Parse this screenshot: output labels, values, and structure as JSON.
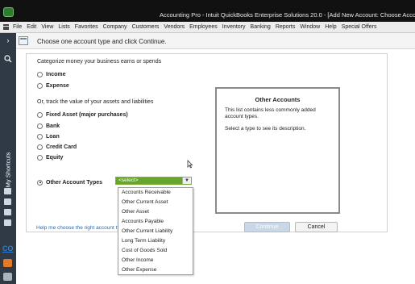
{
  "window": {
    "title": "Accounting Pro - Intuit QuickBooks Enterprise Solutions 20.0 - [Add New Account: Choose Accou"
  },
  "menubar": {
    "items": [
      "File",
      "Edit",
      "View",
      "Lists",
      "Favorites",
      "Company",
      "Customers",
      "Vendors",
      "Employees",
      "Inventory",
      "Banking",
      "Reports",
      "Window",
      "Help",
      "Special Offers"
    ]
  },
  "sidebar": {
    "shortcuts_label": "My Shortcuts",
    "company_badge": "CO"
  },
  "dialog": {
    "instruction": "Choose one account type and click Continue.",
    "categorize_label": "Categorize money your business earns or spends",
    "track_label": "Or, track the value of your assets and liabilities",
    "earn_options": [
      {
        "label": "Income",
        "checked": false
      },
      {
        "label": "Expense",
        "checked": false
      }
    ],
    "asset_options": [
      {
        "label": "Fixed Asset (major purchases)",
        "checked": false
      },
      {
        "label": "Bank",
        "checked": false
      },
      {
        "label": "Loan",
        "checked": false
      },
      {
        "label": "Credit Card",
        "checked": false
      },
      {
        "label": "Equity",
        "checked": false
      }
    ],
    "other_types": {
      "label": "Other Account Types",
      "checked": true,
      "select_value": "<select>",
      "options": [
        "Accounts Receivable",
        "Other Current Asset",
        "Other Asset",
        "Accounts Payable",
        "Other Current Liability",
        "Long Term Liability",
        "Cost of Goods Sold",
        "Other Income",
        "Other Expense"
      ]
    },
    "info": {
      "title": "Other Accounts",
      "description": "This list contains less commonly added account types.",
      "hint": "Select a type to see its description."
    },
    "help_link": "Help me choose the right account typ",
    "continue_label": "Continue",
    "cancel_label": "Cancel"
  }
}
